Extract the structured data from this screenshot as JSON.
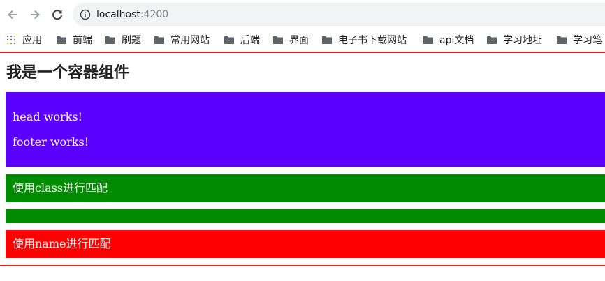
{
  "browser": {
    "back_icon": "arrow-left-icon",
    "forward_icon": "arrow-right-icon",
    "reload_icon": "reload-icon",
    "info_icon": "info-icon",
    "url_host": "localhost",
    "url_port": ":4200"
  },
  "bookmarks": {
    "apps_label": "应用",
    "items": [
      {
        "label": "前端",
        "icon": "folder-icon"
      },
      {
        "label": "刷题",
        "icon": "folder-icon"
      },
      {
        "label": "常用网站",
        "icon": "folder-icon"
      },
      {
        "label": "后端",
        "icon": "folder-icon"
      },
      {
        "label": "界面",
        "icon": "folder-icon"
      },
      {
        "label": "电子书下载网站",
        "icon": "folder-icon"
      },
      {
        "label": "api文档",
        "icon": "folder-icon"
      },
      {
        "label": "学习地址",
        "icon": "folder-icon"
      },
      {
        "label": "学习笔",
        "icon": "folder-icon"
      }
    ]
  },
  "page": {
    "title": "我是一个容器组件",
    "head_text": "head works!",
    "footer_text": "footer works!",
    "class_text": "使用class进行匹配",
    "name_text": "使用name进行匹配"
  },
  "colors": {
    "container_border": "#e0201c",
    "purple_block": "#5b00ff",
    "green_block": "#008b00",
    "red_block": "#ff0000",
    "chrome_icon": "#5f6368",
    "folder": "#5f6368"
  }
}
